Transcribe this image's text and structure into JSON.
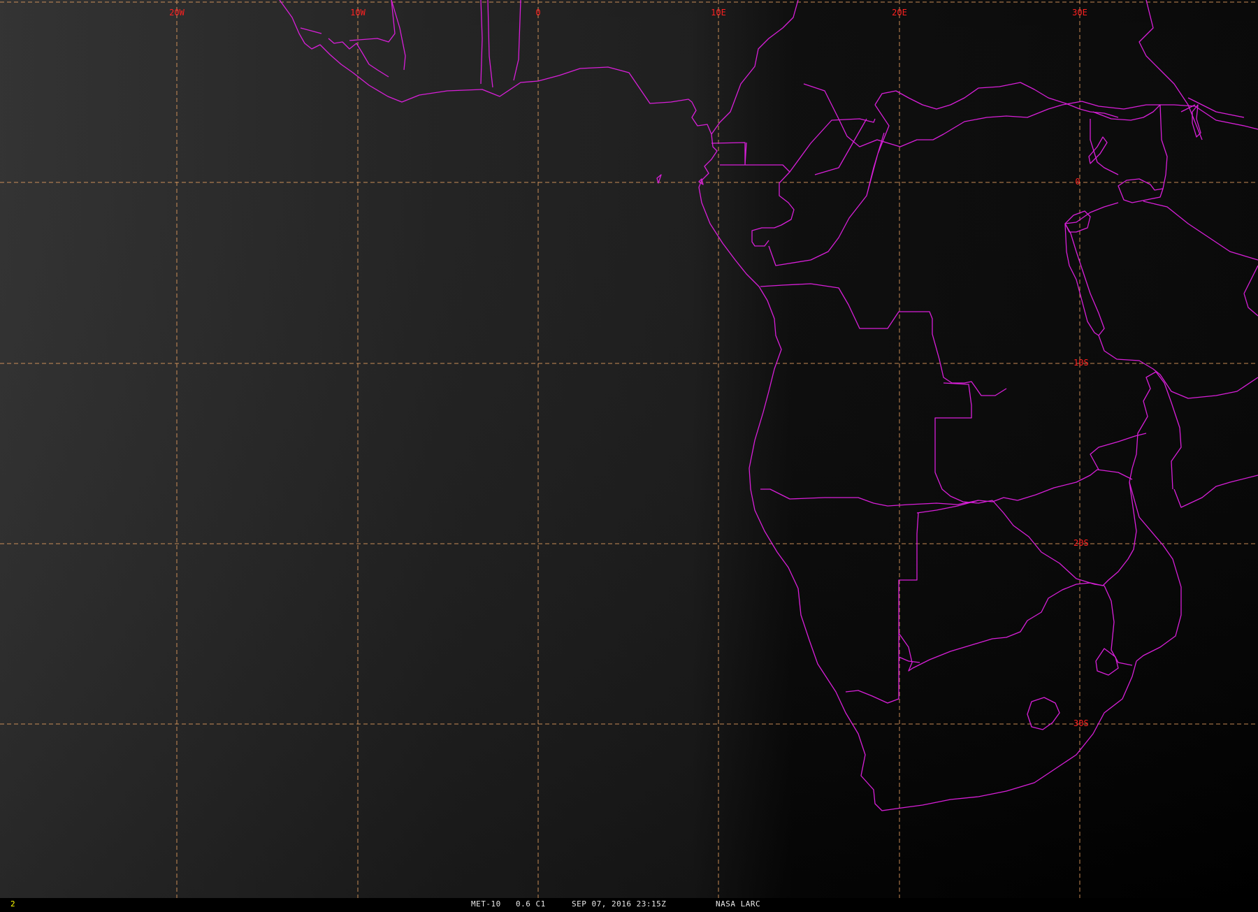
{
  "status_bar": {
    "frame_number": "2",
    "satellite": "MET-10",
    "channel": "0.6 C1",
    "datetime": "SEP 07, 2016 23:15Z",
    "source": "NASA LARC"
  },
  "grid": {
    "longitude_labels": [
      "20W",
      "10W",
      "0",
      "10E",
      "20E",
      "30E"
    ],
    "latitude_labels": [
      "0",
      "10S",
      "20S",
      "30S"
    ]
  },
  "colors": {
    "coastline": "#d81fd8",
    "gridline": "#e8a060",
    "grid_label": "#ff2020",
    "status_text": "#e8e8e8",
    "frame_number": "#ffff00"
  },
  "map": {
    "region": "Southern and Central Africa, South Atlantic",
    "imagery": "visible band, night-time dark terminator"
  }
}
